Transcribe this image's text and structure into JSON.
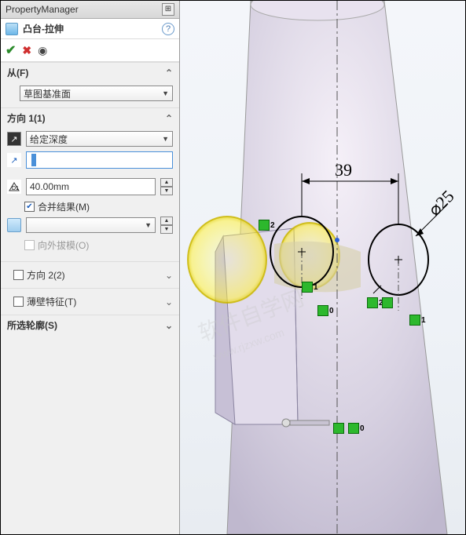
{
  "titlebar": {
    "title": "PropertyManager"
  },
  "feature": {
    "name": "凸台-拉伸"
  },
  "from": {
    "label": "从(F)",
    "value": "草图基准面"
  },
  "dir1": {
    "label": "方向 1(1)",
    "endcond": "给定深度",
    "depth": "40.00mm",
    "merge": "合并结果(M)",
    "draft": "向外拔模(O)"
  },
  "dir2": {
    "label": "方向 2(2)"
  },
  "thin": {
    "label": "薄壁特征(T)"
  },
  "contours": {
    "label": "所选轮廓(S)"
  },
  "viewport": {
    "dim1": "39",
    "dim2": "⌀25"
  }
}
